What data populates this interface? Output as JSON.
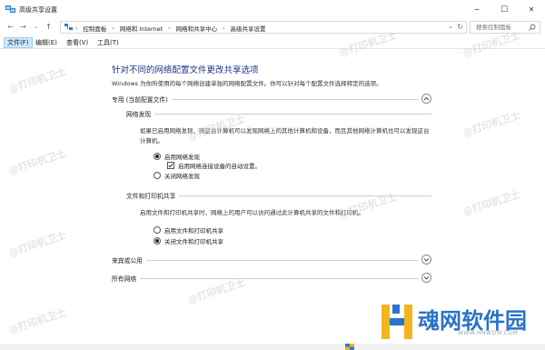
{
  "window": {
    "title": "高级共享设置",
    "minimize_glyph": "─",
    "maximize_glyph": "☐",
    "close_glyph": "✕"
  },
  "address": {
    "crumbs": [
      "控制面板",
      "网络和 Internet",
      "网络和共享中心",
      "高级共享设置"
    ],
    "search_placeholder": "搜索控制面板"
  },
  "menu": {
    "items": [
      "文件(F)",
      "编辑(E)",
      "查看(V)",
      "工具(T)"
    ],
    "active_index": 0
  },
  "main": {
    "title": "针对不同的网络配置文件更改共享选项",
    "description": "Windows 为你所使用的每个网络创建单独的网络配置文件。你可以针对每个配置文件选择特定的选项。",
    "profile_private": {
      "label": "专用 (当前配置文件)",
      "expanded": true,
      "network_discovery": {
        "label": "网络发现",
        "description": "如果已启用网络发现，则这台计算机可以发现网络上的其他计算机和设备，而且其他网络计算机也可以发现这台计算机。",
        "options": [
          {
            "label": "启用网络发现",
            "selected": true
          },
          {
            "label": "关闭网络发现",
            "selected": false
          }
        ],
        "auto_setup": {
          "label": "启用网络连接设备的自动设置。",
          "checked": true
        }
      },
      "file_printer_sharing": {
        "label": "文件和打印机共享",
        "description": "启用文件和打印机共享时，网络上的用户可以访问通过此计算机共享的文件和打印机。",
        "options": [
          {
            "label": "启用文件和打印机共享",
            "selected": false
          },
          {
            "label": "关闭文件和打印机共享",
            "selected": true
          }
        ]
      }
    },
    "profile_guest": {
      "label": "来宾或公用",
      "expanded": false
    },
    "profile_all": {
      "label": "所有网络",
      "expanded": false
    }
  },
  "watermark": {
    "text": "@打印机卫士"
  },
  "logo": {
    "text": "魂网软件园",
    "url": "WWW.HNWDW.COM"
  },
  "colors": {
    "title_blue": "#1e3287",
    "logo_blue": "#2b73c8",
    "menu_active_bg": "#cce8ff"
  }
}
